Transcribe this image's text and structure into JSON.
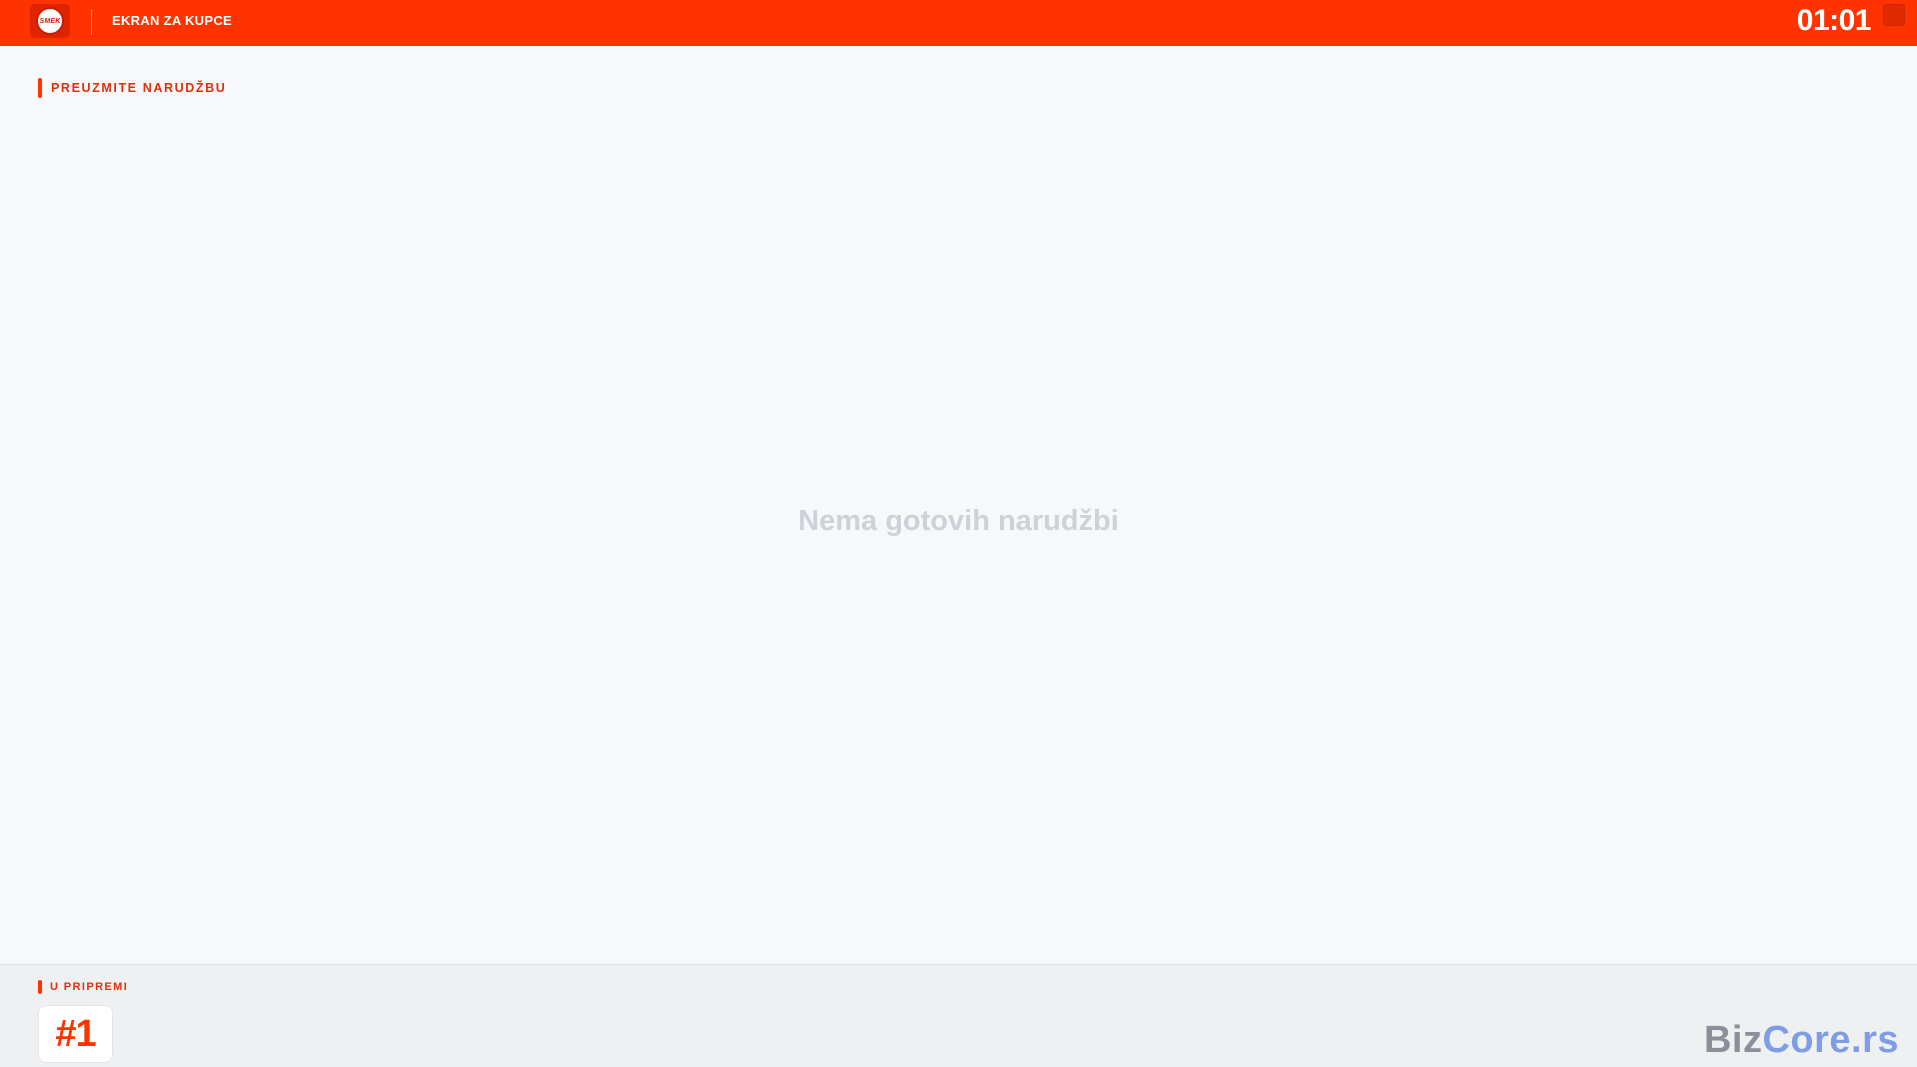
{
  "header": {
    "title": "EKRAN ZA KUPCE",
    "clock": "01:01",
    "logo_text": "SMEK",
    "accent_color": "#ff3300"
  },
  "ready_section": {
    "label": "PREUZMITE NARUDŽBU",
    "empty_message": "Nema gotovih narudžbi"
  },
  "preparing_section": {
    "label": "U PRIPREMI",
    "orders": [
      "#1"
    ]
  },
  "brand": {
    "part1": "Biz",
    "part2": "Core.rs",
    "part1_color": "#8a8f99",
    "part2_color": "#7f9ce6"
  }
}
